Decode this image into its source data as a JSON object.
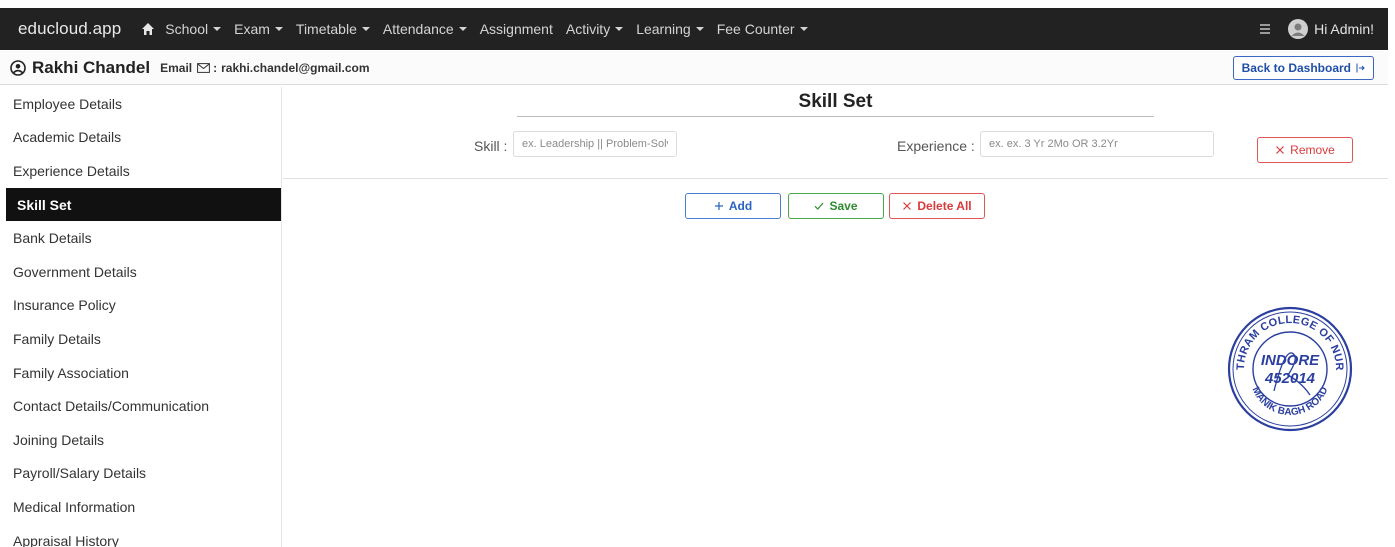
{
  "navbar": {
    "brand": "educloud.app",
    "items": [
      {
        "label": "School",
        "dropdown": true
      },
      {
        "label": "Exam",
        "dropdown": true
      },
      {
        "label": "Timetable",
        "dropdown": true
      },
      {
        "label": "Attendance",
        "dropdown": true
      },
      {
        "label": "Assignment",
        "dropdown": false
      },
      {
        "label": "Activity",
        "dropdown": true
      },
      {
        "label": "Learning",
        "dropdown": true
      },
      {
        "label": "Fee Counter",
        "dropdown": true
      }
    ],
    "user_greeting": "Hi Admin!"
  },
  "employee": {
    "name": "Rakhi Chandel",
    "email_label": "Email",
    "email_separator": ":",
    "email": "rakhi.chandel@gmail.com"
  },
  "back_button": "Back to Dashboard",
  "sidebar": {
    "items": [
      {
        "label": "Employee Details",
        "active": false
      },
      {
        "label": "Academic Details",
        "active": false
      },
      {
        "label": "Experience Details",
        "active": false
      },
      {
        "label": "Skill Set",
        "active": true
      },
      {
        "label": "Bank Details",
        "active": false
      },
      {
        "label": "Government Details",
        "active": false
      },
      {
        "label": "Insurance Policy",
        "active": false
      },
      {
        "label": "Family Details",
        "active": false
      },
      {
        "label": "Family Association",
        "active": false
      },
      {
        "label": "Contact Details/Communication",
        "active": false
      },
      {
        "label": "Joining Details",
        "active": false
      },
      {
        "label": "Payroll/Salary Details",
        "active": false
      },
      {
        "label": "Medical Information",
        "active": false
      },
      {
        "label": "Appraisal History",
        "active": false
      }
    ]
  },
  "main": {
    "title": "Skill Set",
    "skill_label": "Skill :",
    "skill_placeholder": "ex. Leadership || Problem-Solving",
    "skill_value": "",
    "experience_label": "Experience :",
    "experience_placeholder": "ex. ex. 3 Yr 2Mo OR 3.2Yr",
    "experience_value": "",
    "remove_label": "Remove",
    "add_label": "Add",
    "save_label": "Save",
    "delete_all_label": "Delete All"
  },
  "stamp": {
    "text_top": "CHOITHRAM COLLEGE OF NURSING",
    "text_bottom": "MANIK BAGH ROAD",
    "city": "INDORE",
    "pin": "452014"
  },
  "colors": {
    "navbar_bg": "#222222",
    "active_item_bg": "#111111",
    "add_blue": "#2a63c2",
    "save_green": "#2e8b2e",
    "danger_red": "#d83b3b",
    "stamp_blue": "#2b3fa0"
  }
}
